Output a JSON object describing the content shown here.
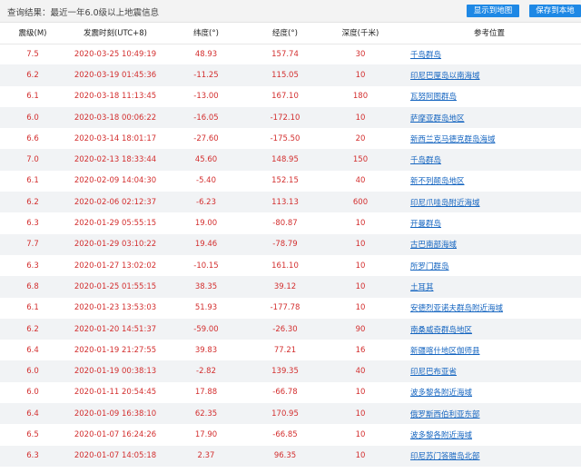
{
  "header": {
    "title": "查询结果：最近一年6.0级以上地震信息",
    "show_map_button": "显示到地图",
    "save_local_button": "保存到本地"
  },
  "columns": [
    "震级(M)",
    "发震时刻(UTC+8)",
    "纬度(°)",
    "经度(°)",
    "深度(千米)",
    "参考位置"
  ],
  "rows": [
    {
      "mag": "7.5",
      "time": "2020-03-25 10:49:19",
      "lat": "48.93",
      "lon": "157.74",
      "depth": "30",
      "loc": "千岛群岛"
    },
    {
      "mag": "6.2",
      "time": "2020-03-19 01:45:36",
      "lat": "-11.25",
      "lon": "115.05",
      "depth": "10",
      "loc": "印尼巴厘岛以南海域"
    },
    {
      "mag": "6.1",
      "time": "2020-03-18 11:13:45",
      "lat": "-13.00",
      "lon": "167.10",
      "depth": "180",
      "loc": "瓦努阿图群岛"
    },
    {
      "mag": "6.0",
      "time": "2020-03-18 00:06:22",
      "lat": "-16.05",
      "lon": "-172.10",
      "depth": "10",
      "loc": "萨摩亚群岛地区"
    },
    {
      "mag": "6.6",
      "time": "2020-03-14 18:01:17",
      "lat": "-27.60",
      "lon": "-175.50",
      "depth": "20",
      "loc": "新西兰克马德克群岛海域"
    },
    {
      "mag": "7.0",
      "time": "2020-02-13 18:33:44",
      "lat": "45.60",
      "lon": "148.95",
      "depth": "150",
      "loc": "千岛群岛"
    },
    {
      "mag": "6.1",
      "time": "2020-02-09 14:04:30",
      "lat": "-5.40",
      "lon": "152.15",
      "depth": "40",
      "loc": "新不列颠岛地区"
    },
    {
      "mag": "6.2",
      "time": "2020-02-06 02:12:37",
      "lat": "-6.23",
      "lon": "113.13",
      "depth": "600",
      "loc": "印尼爪哇岛附近海域"
    },
    {
      "mag": "6.3",
      "time": "2020-01-29 05:55:15",
      "lat": "19.00",
      "lon": "-80.87",
      "depth": "10",
      "loc": "开曼群岛"
    },
    {
      "mag": "7.7",
      "time": "2020-01-29 03:10:22",
      "lat": "19.46",
      "lon": "-78.79",
      "depth": "10",
      "loc": "古巴南部海域"
    },
    {
      "mag": "6.3",
      "time": "2020-01-27 13:02:02",
      "lat": "-10.15",
      "lon": "161.10",
      "depth": "10",
      "loc": "所罗门群岛"
    },
    {
      "mag": "6.8",
      "time": "2020-01-25 01:55:15",
      "lat": "38.35",
      "lon": "39.12",
      "depth": "10",
      "loc": "土耳其"
    },
    {
      "mag": "6.1",
      "time": "2020-01-23 13:53:03",
      "lat": "51.93",
      "lon": "-177.78",
      "depth": "10",
      "loc": "安德烈亚诺夫群岛附近海域"
    },
    {
      "mag": "6.2",
      "time": "2020-01-20 14:51:37",
      "lat": "-59.00",
      "lon": "-26.30",
      "depth": "90",
      "loc": "南桑威奇群岛地区"
    },
    {
      "mag": "6.4",
      "time": "2020-01-19 21:27:55",
      "lat": "39.83",
      "lon": "77.21",
      "depth": "16",
      "loc": "新疆喀什地区伽师县"
    },
    {
      "mag": "6.0",
      "time": "2020-01-19 00:38:13",
      "lat": "-2.82",
      "lon": "139.35",
      "depth": "40",
      "loc": "印尼巴布亚省"
    },
    {
      "mag": "6.0",
      "time": "2020-01-11 20:54:45",
      "lat": "17.88",
      "lon": "-66.78",
      "depth": "10",
      "loc": "波多黎各附近海域"
    },
    {
      "mag": "6.4",
      "time": "2020-01-09 16:38:10",
      "lat": "62.35",
      "lon": "170.95",
      "depth": "10",
      "loc": "俄罗斯西伯利亚东部"
    },
    {
      "mag": "6.5",
      "time": "2020-01-07 16:24:26",
      "lat": "17.90",
      "lon": "-66.85",
      "depth": "10",
      "loc": "波多黎各附近海域"
    },
    {
      "mag": "6.3",
      "time": "2020-01-07 14:05:18",
      "lat": "2.37",
      "lon": "96.35",
      "depth": "10",
      "loc": "印尼苏门答腊岛北部"
    }
  ]
}
